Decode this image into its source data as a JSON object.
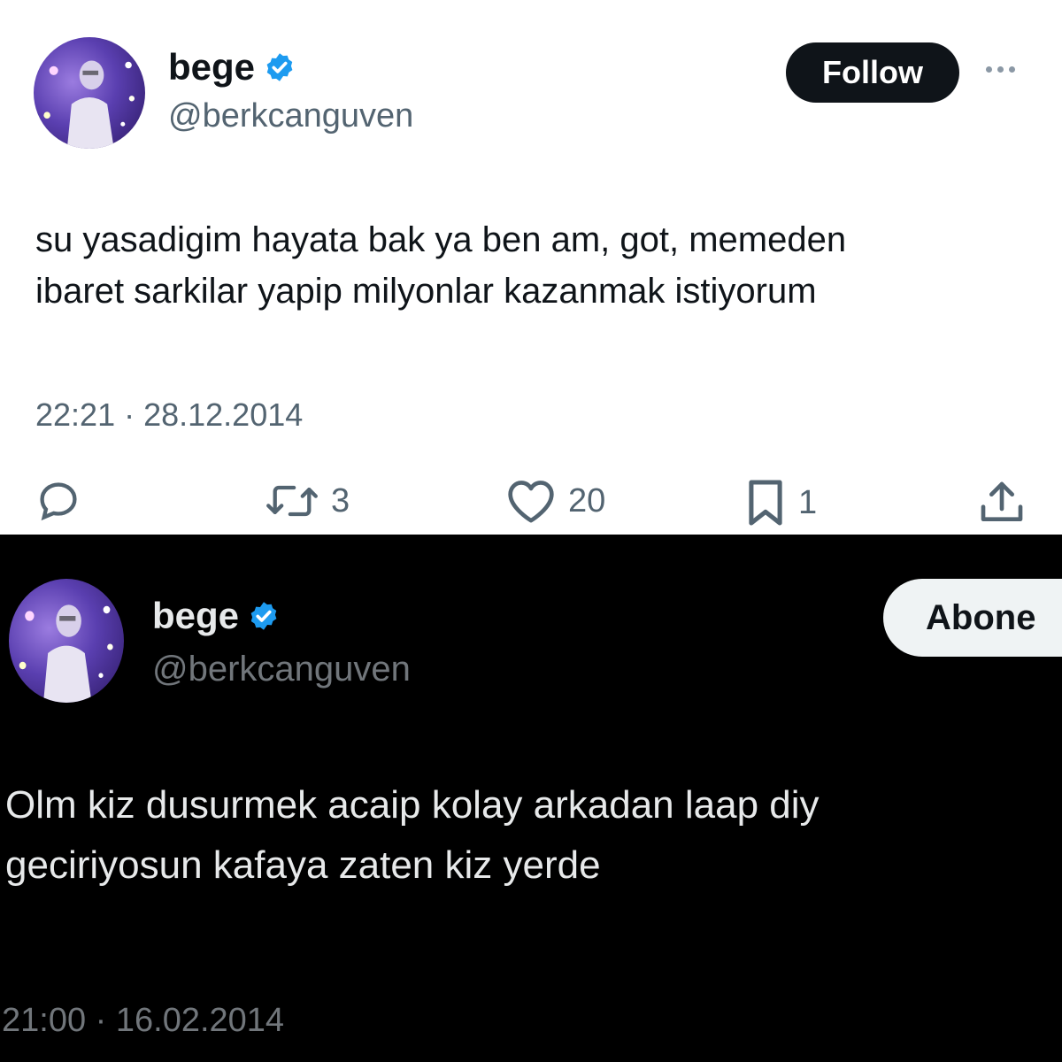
{
  "tweets": [
    {
      "theme": "light",
      "author": {
        "name": "bege",
        "handle": "@berkcanguven",
        "verified": true
      },
      "follow_label": "Follow",
      "text_lines": [
        "su yasadigim hayata bak ya ben am, got, memeden",
        "ibaret sarkilar yapip milyonlar kazanmak istiyorum"
      ],
      "timestamp": "22:21 · 28.12.2014",
      "actions": {
        "reply": {
          "icon": "reply-icon",
          "count": ""
        },
        "retweet": {
          "icon": "retweet-icon",
          "count": "3"
        },
        "like": {
          "icon": "heart-icon",
          "count": "20"
        },
        "bookmark": {
          "icon": "bookmark-icon",
          "count": "1"
        },
        "share": {
          "icon": "share-icon",
          "count": ""
        }
      }
    },
    {
      "theme": "dark",
      "author": {
        "name": "bege",
        "handle": "@berkcanguven",
        "verified": true
      },
      "follow_label": "Abone",
      "text_lines": [
        "Olm kiz dusurmek acaip kolay arkadan laap diy",
        "geciriyosun kafaya zaten kiz yerde"
      ],
      "timestamp": "21:00 · 16.02.2014"
    }
  ],
  "colors": {
    "verified_blue": "#1d9bf0",
    "light_text": "#0f1419",
    "light_secondary": "#536471",
    "dark_text": "#e7e9ea",
    "dark_secondary": "#71767b"
  }
}
